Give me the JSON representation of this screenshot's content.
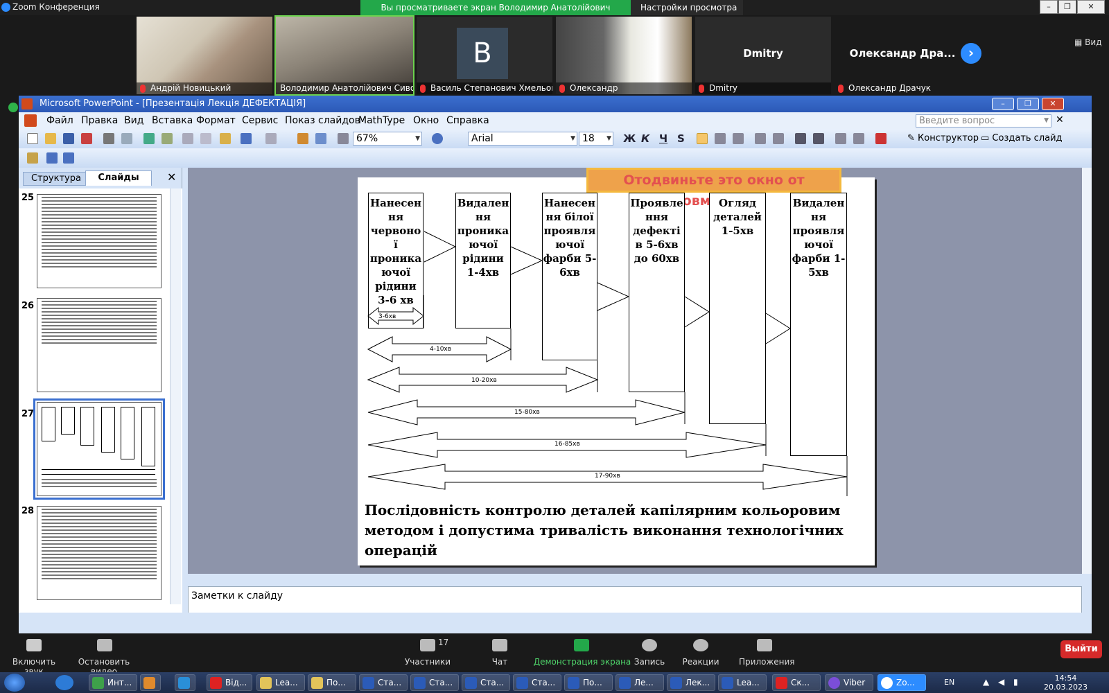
{
  "zoom": {
    "window_title": "Zoom Конференция",
    "share_banner": "Вы просматриваете экран Володимир Анатолійович Сиволап...",
    "view_settings": "Настройки просмотра",
    "view_label": "Вид",
    "participants": [
      {
        "name": "Андрій Новицький"
      },
      {
        "name": "Володимир Анатолійович Сиво..."
      },
      {
        "name": "Василь Степанович Хмельов...",
        "initial": "B"
      },
      {
        "name": "Олександр"
      },
      {
        "name": "Dmitry",
        "center": "Dmitry"
      },
      {
        "name": "Олександр Драчук",
        "center": "Олександр  Дра..."
      }
    ],
    "bottom": {
      "mute": "Включить звук",
      "video": "Остановить видео",
      "participants": "Участники",
      "participants_count": "17",
      "chat": "Чат",
      "share": "Демонстрация экрана",
      "record": "Запись",
      "reactions": "Реакции",
      "apps": "Приложения",
      "exit": "Выйти"
    }
  },
  "ppt": {
    "title": "Microsoft PowerPoint - [Презентація  Лекція ДЕФЕКТАЦІЯ]",
    "menu": [
      "Файл",
      "Правка",
      "Вид",
      "Вставка",
      "Формат",
      "Сервис",
      "Показ слайдов",
      "MathType",
      "Окно",
      "Справка"
    ],
    "ask_placeholder": "Введите вопрос",
    "zoom": "67%",
    "font": "Arial",
    "font_size": "18",
    "fmt": {
      "bold": "Ж",
      "italic": "К",
      "underline": "Ч",
      "shadow": "S"
    },
    "designer": "Конструктор",
    "new_slide": "Создать слайд",
    "tabs": {
      "structure": "Структура",
      "slides": "Слайды"
    },
    "slide_numbers": [
      "25",
      "26",
      "27",
      "28"
    ],
    "notes_placeholder": "Заметки к слайду",
    "share_warning": "Отодвиньте это окно от совместно"
  },
  "slide": {
    "columns": [
      "Нанесен ня червоно ї проника ючої рідини 3-6 хв",
      "Видален ня проника ючої рідини 1-4хв",
      "Нанесен ня білої проявля ючої фарби 5-6хв",
      "Проявле ння дефекті в 5-6хв до 60хв",
      "Огляд деталей 1-5хв",
      "Видален ня проявля ючої фарби 1-5хв"
    ],
    "durations": [
      "3-6хв",
      "4-10хв",
      "10-20хв",
      "15-80хв",
      "16-85хв",
      "17-90хв"
    ],
    "caption": "Послідовність контролю деталей капілярним кольоровим методом і допустима тривалість виконання технологічних операцій"
  },
  "taskbar": {
    "items": [
      "Инт...",
      "",
      "",
      "Від...",
      "Lea...",
      "По...",
      "Ста...",
      "Ста...",
      "Ста...",
      "Ста...",
      "По...",
      "Ле...",
      "Лек...",
      "Lea...",
      "Ск...",
      "Viber",
      "Zo..."
    ],
    "lang": "EN",
    "time": "14:54",
    "date": "20.03.2023"
  }
}
